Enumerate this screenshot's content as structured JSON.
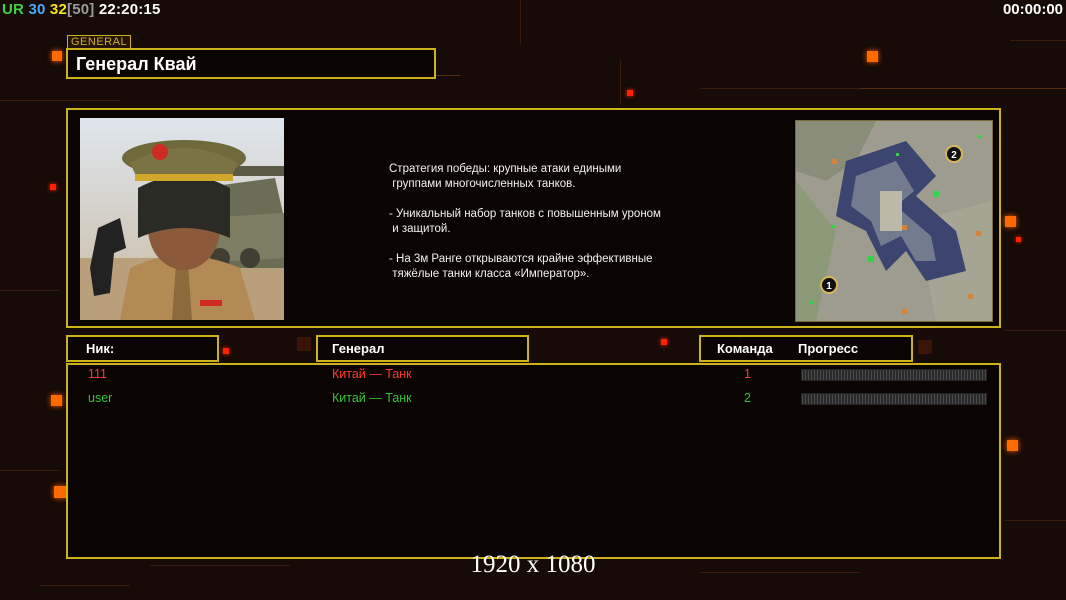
{
  "hud": {
    "ur": "UR",
    "v30": "30",
    "v32": "32",
    "v50": "[50]",
    "clock": "22:20:15",
    "timer": "00:00:00"
  },
  "general": {
    "tag": "GENERAL",
    "name": "Генерал Квай",
    "description": "Стратегия победы: крупные атаки едиными\n группами многочисленных танков.\n\n- Уникальный набор танков с повышенным уроном\n и защитой.\n\n- На 3м Ранге открываются крайне эффективные\n тяжёлые танки класса «Император»."
  },
  "minimap": {
    "spawn1": "1",
    "spawn2": "2"
  },
  "table": {
    "headers": {
      "nick": "Ник:",
      "general": "Генерал",
      "team": "Команда",
      "progress": "Прогресс"
    },
    "players": [
      {
        "nick": "111",
        "faction": "Китай — Танк",
        "team": "1",
        "color": "#ff3b2a"
      },
      {
        "nick": "user",
        "faction": "Китай — Танк",
        "team": "2",
        "color": "#36c236"
      }
    ]
  },
  "resolution": "1920 x 1080",
  "colors": {
    "accent": "#cdb21c",
    "glow": "#ff6a00",
    "background": "#160b06"
  }
}
